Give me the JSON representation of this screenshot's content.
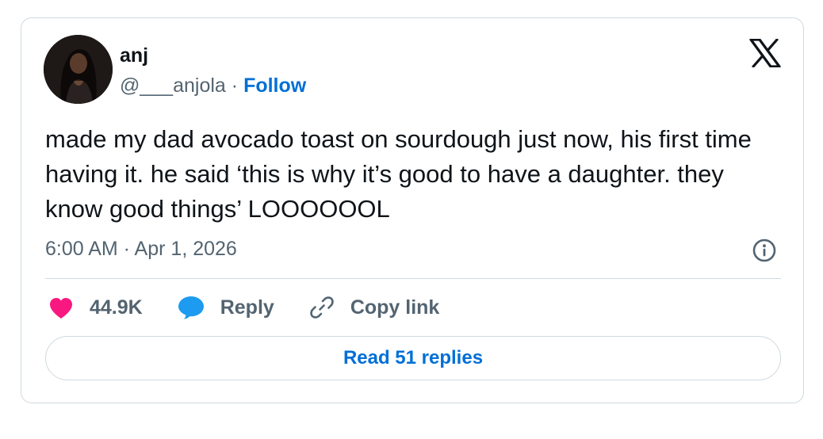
{
  "author": {
    "display_name": "anj",
    "handle": "@___anjola",
    "separator": "·",
    "follow_label": "Follow"
  },
  "tweet": {
    "text": "made my dad avocado toast on sourdough just now, his first time having it. he said ‘this is why it’s good to have a daughter. they know good things’ LOOOOOOL",
    "timestamp": "6:00 AM · Apr 1, 2026"
  },
  "actions": {
    "like_count": "44.9K",
    "reply_label": "Reply",
    "copy_link_label": "Copy link"
  },
  "read_replies_label": "Read 51 replies",
  "icons": {
    "platform_logo": "x-logo-icon",
    "info": "info-icon",
    "like": "heart-icon",
    "reply": "speech-bubble-icon",
    "copy_link": "link-icon"
  },
  "colors": {
    "like": "#f91880",
    "reply": "#1d9bf0",
    "link": "#006fd6",
    "secondary_text": "#536471",
    "border": "#cfd9de"
  }
}
